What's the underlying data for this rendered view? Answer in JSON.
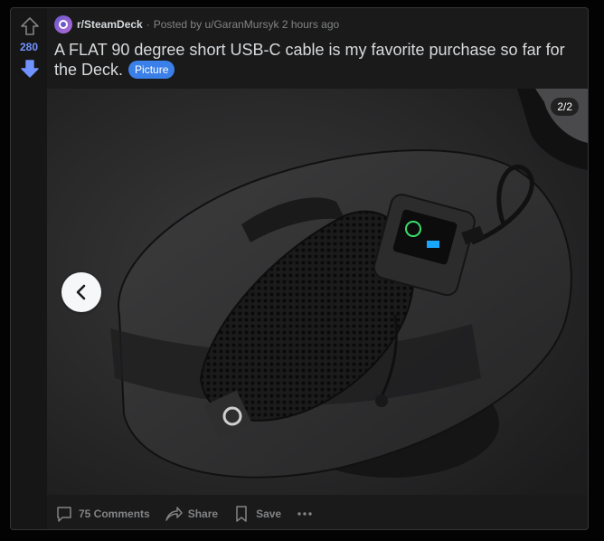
{
  "post": {
    "score": "280",
    "subreddit": "r/SteamDeck",
    "posted_by_prefix": "Posted by",
    "username": "u/GaranMursyk",
    "time_ago": "2 hours ago",
    "title": "A FLAT 90 degree short USB-C cable is my favorite purchase so far for the Deck.",
    "flair": "Picture",
    "gallery_counter": "2/2",
    "actions": {
      "comments": "75 Comments",
      "share": "Share",
      "save": "Save"
    }
  },
  "colors": {
    "background": "#030303",
    "card": "#1a1a1b",
    "vote_active": "#7193ff",
    "flair": "#3a80e8"
  },
  "icons": [
    "upvote-icon",
    "downvote-icon",
    "subreddit-icon",
    "chevron-left-icon",
    "comment-icon",
    "share-icon",
    "bookmark-icon",
    "more-icon"
  ]
}
